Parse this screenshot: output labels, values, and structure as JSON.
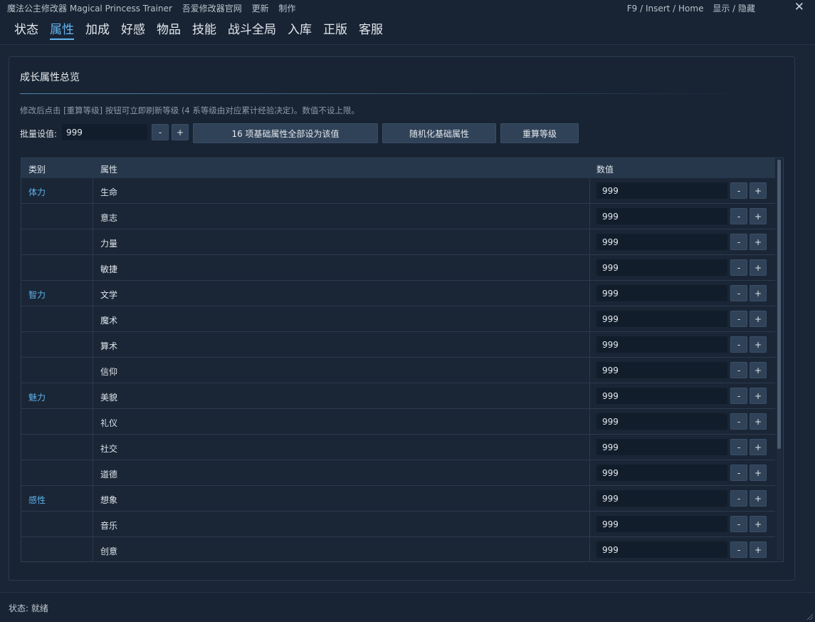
{
  "titlebar": {
    "app_title": "魔法公主修改器 Magical Princess Trainer",
    "links": [
      "吾爱修改器官网",
      "更新",
      "制作"
    ],
    "hotkey": "F9 / Insert / Home",
    "toggle": "显示 / 隐藏",
    "close": "✕"
  },
  "tabs": [
    {
      "label": "状态"
    },
    {
      "label": "属性",
      "active": true
    },
    {
      "label": "加成"
    },
    {
      "label": "好感"
    },
    {
      "label": "物品"
    },
    {
      "label": "技能"
    },
    {
      "label": "战斗全局"
    },
    {
      "label": "入库"
    },
    {
      "label": "正版"
    },
    {
      "label": "客服"
    }
  ],
  "panel": {
    "title": "成长属性总览",
    "hint": "修改后点击 [重算等级] 按钮可立即刷新等级 (4 系等级由对应累计经验决定)。数值不设上限。",
    "batch_label": "批量设值:",
    "batch_value": "999",
    "minus": "-",
    "plus": "+",
    "set_all_label": "16 项基础属性全部设为该值",
    "randomize_label": "随机化基础属性",
    "recalc_label": "重算等级"
  },
  "table": {
    "headers": {
      "category": "类别",
      "attribute": "属性",
      "value": "数值"
    },
    "rows": [
      {
        "category": "体力",
        "attribute": "生命",
        "value": "999"
      },
      {
        "category": "",
        "attribute": "意志",
        "value": "999"
      },
      {
        "category": "",
        "attribute": "力量",
        "value": "999"
      },
      {
        "category": "",
        "attribute": "敏捷",
        "value": "999"
      },
      {
        "category": "智力",
        "attribute": "文学",
        "value": "999"
      },
      {
        "category": "",
        "attribute": "魔术",
        "value": "999"
      },
      {
        "category": "",
        "attribute": "算术",
        "value": "999"
      },
      {
        "category": "",
        "attribute": "信仰",
        "value": "999"
      },
      {
        "category": "魅力",
        "attribute": "美貌",
        "value": "999"
      },
      {
        "category": "",
        "attribute": "礼仪",
        "value": "999"
      },
      {
        "category": "",
        "attribute": "社交",
        "value": "999"
      },
      {
        "category": "",
        "attribute": "道德",
        "value": "999"
      },
      {
        "category": "感性",
        "attribute": "想象",
        "value": "999"
      },
      {
        "category": "",
        "attribute": "音乐",
        "value": "999"
      },
      {
        "category": "",
        "attribute": "创意",
        "value": "999"
      }
    ]
  },
  "status": {
    "text": "状态: 就绪"
  },
  "colors": {
    "accent": "#64b5ef",
    "background": "#1a2636",
    "button": "#304258"
  }
}
